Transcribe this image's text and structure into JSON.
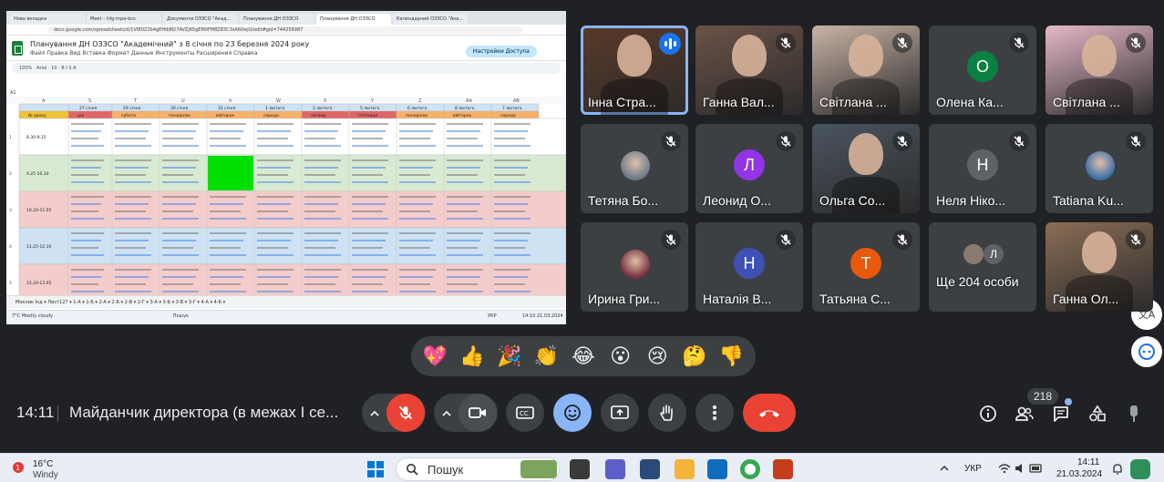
{
  "shared_screen": {
    "browser_tabs": [
      "Нова вкладка",
      "Meet – hfg-rnpe-bcs",
      "Документи ОЗЗСО \"Акад...",
      "Планування ДН ОЗЗСО",
      "Планування ДН ОЗЗСО",
      "Календарний ОЗЗСО \"Ака..."
    ],
    "url": "docs.google.com/spreadsheets/d/1VtE0Z2b4gEHIbM27AVZj65gEM0FM8Z83C3sA60wjU/edit#gid=744256987",
    "doc_title": "Планування ДН ОЗЗСО \"Академічний\" з 8 січня по 23 березня 2024 року",
    "menu": "Файл  Правка  Вид  Вставка  Формат  Данные  Инструменты  Расширения  Справка",
    "share_label": "Настройки Доступа",
    "toolbar_text": "100%  ·  Arial  ·  10  ·  B  I  S  A",
    "cell_ref": "A1",
    "col_letters": [
      "A",
      "S",
      "T",
      "U",
      "V",
      "W",
      "X",
      "Y",
      "Z",
      "AA",
      "AB"
    ],
    "header_row1": [
      "",
      "27 січня",
      "29 січня",
      "30 січня",
      "31 січня",
      "1 лютого",
      "2 лютого",
      "5 лютого",
      "6 лютого",
      "8 лютого",
      "7 лютого"
    ],
    "header_row2": [
      "№ уроку",
      "ція",
      "субота",
      "понеділок",
      "вівторок",
      "середа",
      "четвер",
      "п'ятниця",
      "понеділок",
      "вівторок",
      "середа"
    ],
    "lesson_times": [
      "8.30-9.15",
      "9.25-10.10",
      "10.20-11.05",
      "11.25-12.10",
      "12.20-13.05"
    ],
    "row_numbers": [
      "1",
      "2",
      "3",
      "4",
      "5"
    ],
    "sheet_tabs": "Моклик Інд ▾   Лист127 ▾   1-А ▾   1-Б ▾   2-А ▾   2-Б ▾   2-В ▾   2-Г ▾   3-А ▾   3-Б ▾   3-В ▾   3-Г ▾   4-А ▾   4-Б ▾",
    "mini_weather": "7°C Mostly cloudy",
    "mini_search": "Пошук",
    "mini_clock": "14:10 21.03.2024",
    "mini_lang": "УКР"
  },
  "participants": [
    {
      "name": "Інна Стра...",
      "speaking": true,
      "avatar_letter": "",
      "avatar_color": "#5b3a2a"
    },
    {
      "name": "Ганна Вал...",
      "speaking": false,
      "avatar_letter": "",
      "avatar_color": "#6b5248"
    },
    {
      "name": "Світлана ...",
      "speaking": false,
      "avatar_letter": "",
      "avatar_color": "#c9b3a6"
    },
    {
      "name": "Олена Ка...",
      "speaking": false,
      "avatar_letter": "О",
      "avatar_color": "#0b8043"
    },
    {
      "name": "Світлана ...",
      "speaking": false,
      "avatar_letter": "",
      "avatar_color": "#e6b8c8"
    },
    {
      "name": "Тетяна Бо...",
      "speaking": false,
      "avatar_letter": "",
      "avatar_color": "#6a7a8a"
    },
    {
      "name": "Леонид О...",
      "speaking": false,
      "avatar_letter": "Л",
      "avatar_color": "#9334e6"
    },
    {
      "name": "Ольга Со...",
      "speaking": false,
      "avatar_letter": "",
      "avatar_color": "#4a5560"
    },
    {
      "name": "Неля Ніко...",
      "speaking": false,
      "avatar_letter": "Н",
      "avatar_color": "#5f6368"
    },
    {
      "name": "Tatiana Ku...",
      "speaking": false,
      "avatar_letter": "",
      "avatar_color": "#3b6ea8"
    },
    {
      "name": "Ирина Гри...",
      "speaking": false,
      "avatar_letter": "",
      "avatar_color": "#7a3040"
    },
    {
      "name": "Наталія В...",
      "speaking": false,
      "avatar_letter": "Н",
      "avatar_color": "#3f51b5"
    },
    {
      "name": "Татьяна С...",
      "speaking": false,
      "avatar_letter": "Т",
      "avatar_color": "#e8590c"
    },
    {
      "name": "Ще 204 особи",
      "speaking": false,
      "avatar_letter": "Л",
      "avatar_color": "#5f6368"
    },
    {
      "name": "Ганна Ол...",
      "speaking": false,
      "avatar_letter": "",
      "avatar_color": "#8a6d56"
    }
  ],
  "reactions": [
    "💖",
    "👍",
    "🎉",
    "👏",
    "😂",
    "😮",
    "😢",
    "🤔",
    "👎"
  ],
  "bottom_bar": {
    "time": "14:11",
    "meeting_title": "Майданчик директора (в межах І се...",
    "people_count": "218"
  },
  "side_buttons": {
    "translate": "文A"
  },
  "taskbar": {
    "weather_temp": "16°C",
    "weather_desc": "Windy",
    "search_placeholder": "Пошук",
    "lang": "УКР",
    "clock_time": "14:11",
    "clock_date": "21.03.2024",
    "colors": {
      "accent": "#0078d4"
    }
  },
  "colors": {
    "meet_bg": "#202124",
    "tile_bg": "#3c4043",
    "end_call": "#ea4335",
    "speaking_outline": "#8ab4f8"
  }
}
